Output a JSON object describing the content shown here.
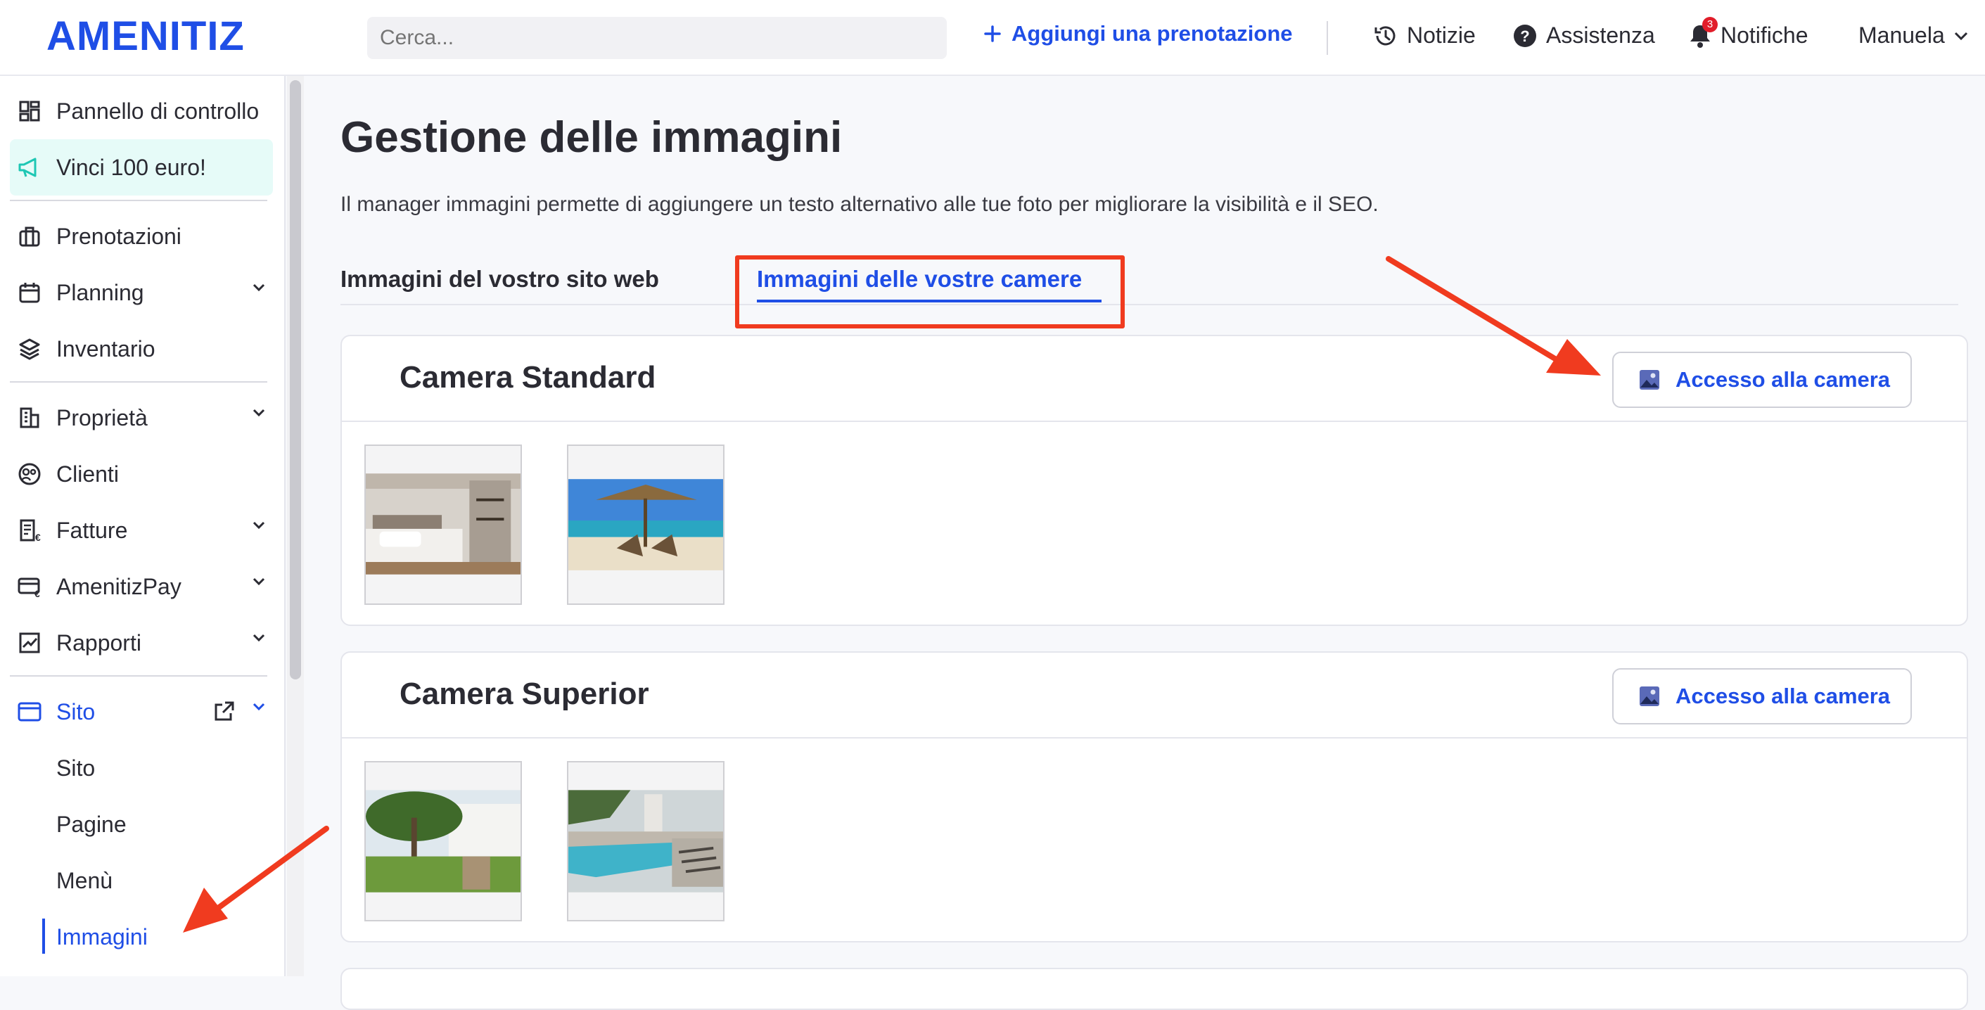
{
  "header": {
    "logo": "AMENITIZ",
    "search_placeholder": "Cerca...",
    "add_booking": "Aggiungi una prenotazione",
    "news": "Notizie",
    "support": "Assistenza",
    "notifications": "Notifiche",
    "notifications_count": "3",
    "user": "Manuela"
  },
  "sidebar": {
    "items": [
      {
        "label": "Pannello di controllo"
      },
      {
        "label": "Vinci 100 euro!"
      },
      {
        "label": "Prenotazioni"
      },
      {
        "label": "Planning"
      },
      {
        "label": "Inventario"
      },
      {
        "label": "Proprietà"
      },
      {
        "label": "Clienti"
      },
      {
        "label": "Fatture"
      },
      {
        "label": "AmenitizPay"
      },
      {
        "label": "Rapporti"
      },
      {
        "label": "Sito"
      }
    ],
    "sub_items": [
      {
        "label": "Sito"
      },
      {
        "label": "Pagine"
      },
      {
        "label": "Menù"
      },
      {
        "label": "Immagini"
      }
    ]
  },
  "main": {
    "title": "Gestione delle immagini",
    "description": "Il manager immagini permette di aggiungere un testo alternativo alle tue foto per migliorare la visibilità e il SEO.",
    "tabs": [
      {
        "label": "Immagini del vostro sito web"
      },
      {
        "label": "Immagini delle vostre camere"
      }
    ],
    "rooms": [
      {
        "name": "Camera Standard",
        "button": "Accesso alla camera"
      },
      {
        "name": "Camera Superior",
        "button": "Accesso alla camera"
      }
    ]
  },
  "colors": {
    "accent": "#1f4ee6",
    "annotation": "#f03b1f",
    "highlight_bg": "#e6fbf8"
  }
}
